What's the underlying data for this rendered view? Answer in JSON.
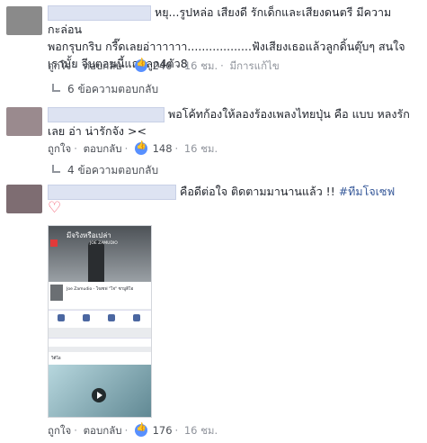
{
  "comments": [
    {
      "text_line1": "หยุ...รูปหล่อ เสียงดี รักเด็กและเสียงดนตรี มีความกะล่อน",
      "text_line2": "พอกรุบกริบ กรี๊ดเลยอ่าาาาาา..................ฟังเสียงเธอแล้วลูกดิ้นตุ๊บๆ สนใจ",
      "text_line3": "เรามั้ย จีบตอนนี้แถมลูก4ตัว8",
      "like_label": "ถูกใจ",
      "reply_label": "ตอบกลับ",
      "like_count": "240",
      "time": "16 ชม.",
      "edited": "มีการแก้ไข",
      "replies_text": "6 ข้อความตอบกลับ",
      "avatar_color": "#8a8a8a"
    },
    {
      "text_line1": "พอโค้ทก้องให้ลองร้องเพลงไทยปุ่น คือ แบบ หลงรัก",
      "text_line2": "เลย อ่า น่ารักจัง ><",
      "like_label": "ถูกใจ",
      "reply_label": "ตอบกลับ",
      "like_count": "148",
      "time": "16 ชม.",
      "replies_text": "4 ข้อความตอบกลับ",
      "avatar_color": "#9a8a8e"
    },
    {
      "text_line1": "คือดีต่อใจ ติดตามมานานแล้ว !! ",
      "hashtag": "#ทีมโจเซฟ",
      "heart": "♡",
      "like_label": "ถูกใจ",
      "reply_label": "ตอบกลับ",
      "like_count": "176",
      "time": "16 ชม.",
      "avatar_color": "#7e6d72"
    }
  ],
  "embedded": {
    "banner_title": "มีจริงหรือเปล่า",
    "banner_sub": "JOE ZAMUDIO",
    "profile_name": "Joe Zamudio - โจเซฟ \"โจ\" ซามูดิโอ",
    "video_label": "วิดีโอ"
  },
  "colors": {
    "link": "#4b4f56",
    "meta": "#90949c",
    "like_badge": "#5890ff",
    "hashtag": "#365899",
    "heart": "#f25268"
  }
}
